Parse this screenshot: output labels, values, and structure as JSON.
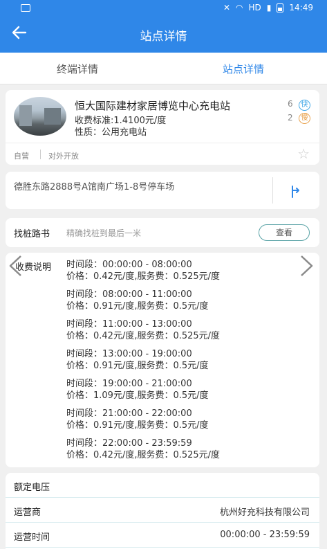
{
  "status_bar": {
    "time": "14:49",
    "network": "HD"
  },
  "app_bar": {
    "title": "站点详情"
  },
  "tabs": [
    {
      "label": "终端详情",
      "active": false
    },
    {
      "label": "站点详情",
      "active": true
    }
  ],
  "station": {
    "name": "恒大国际建材家居博览中心充电站",
    "price": "收费标准:1.4100元/度",
    "nature": "性质：公用充电站",
    "fast_count": "6",
    "fast_label": "快",
    "slow_count": "2",
    "slow_label": "慢",
    "tags": [
      "自营",
      "对外开放"
    ]
  },
  "address": {
    "text": "德胜东路2888号A馆南广场1-8号停车场"
  },
  "finder": {
    "label": "找桩路书",
    "hint": "精确找桩到最后一米",
    "button": "查看"
  },
  "fees": {
    "label": "收费说明",
    "items": [
      {
        "period": "时间段：00:00:00 - 08:00:00",
        "price": "价格：0.42元/度,服务费：0.525元/度"
      },
      {
        "period": "时间段：08:00:00 - 11:00:00",
        "price": "价格：0.91元/度,服务费：0.5元/度"
      },
      {
        "period": "时间段：11:00:00 - 13:00:00",
        "price": "价格：0.42元/度,服务费：0.525元/度"
      },
      {
        "period": "时间段：13:00:00 - 19:00:00",
        "price": "价格：0.91元/度,服务费：0.5元/度"
      },
      {
        "period": "时间段：19:00:00 - 21:00:00",
        "price": "价格：1.09元/度,服务费：0.5元/度"
      },
      {
        "period": "时间段：21:00:00 - 22:00:00",
        "price": "价格：0.91元/度,服务费：0.5元/度"
      },
      {
        "period": "时间段：22:00:00 - 23:59:59",
        "price": "价格：0.42元/度,服务费：0.525元/度"
      }
    ]
  },
  "info": {
    "rows": [
      {
        "key": "额定电压",
        "value": ""
      },
      {
        "key": "运营商",
        "value": "杭州好充科技有限公司"
      },
      {
        "key": "运营时间",
        "value": "00:00:00 - 23:59:59"
      }
    ]
  },
  "colors": {
    "primary": "#2f87e8",
    "fast": "#3ea6e6",
    "slow": "#e8a04a"
  }
}
